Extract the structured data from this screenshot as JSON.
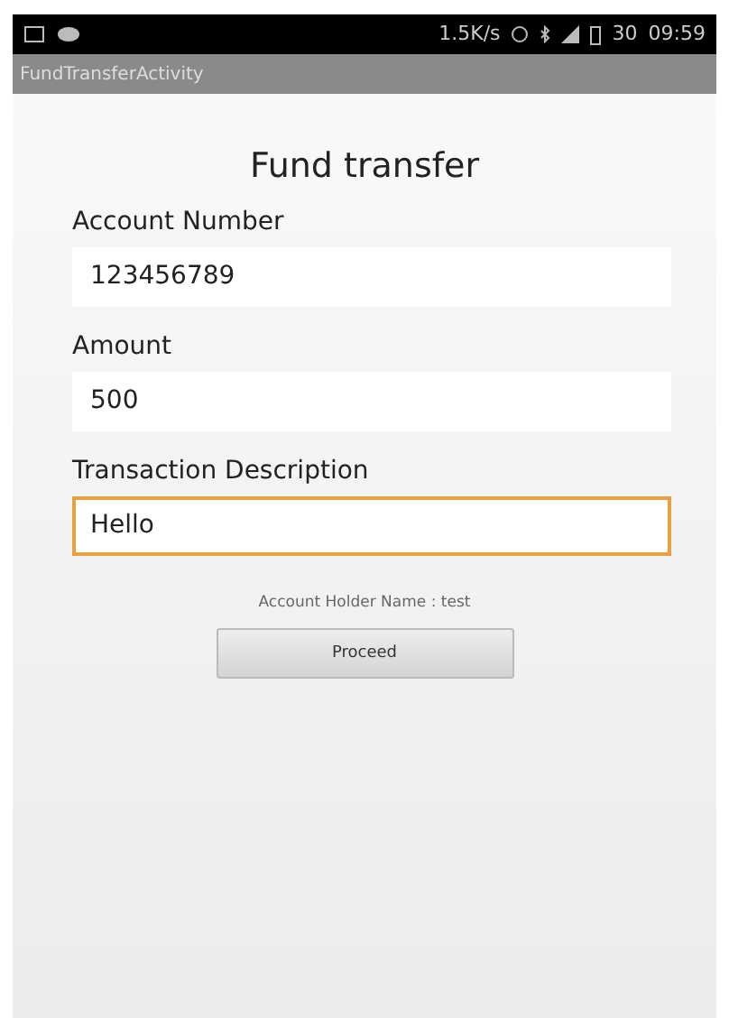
{
  "status_bar": {
    "speed": "1.5K/s",
    "battery": "30",
    "time": "09:59"
  },
  "action_bar": {
    "title": "FundTransferActivity"
  },
  "heading": "Fund transfer",
  "fields": [
    {
      "label": "Account Number",
      "value": "123456789",
      "focused": false
    },
    {
      "label": "Amount",
      "value": "500",
      "focused": false
    },
    {
      "label": "Transaction Description",
      "value": "Hello",
      "focused": true
    }
  ],
  "holder_text": "Account Holder Name : test",
  "button": "Proceed"
}
